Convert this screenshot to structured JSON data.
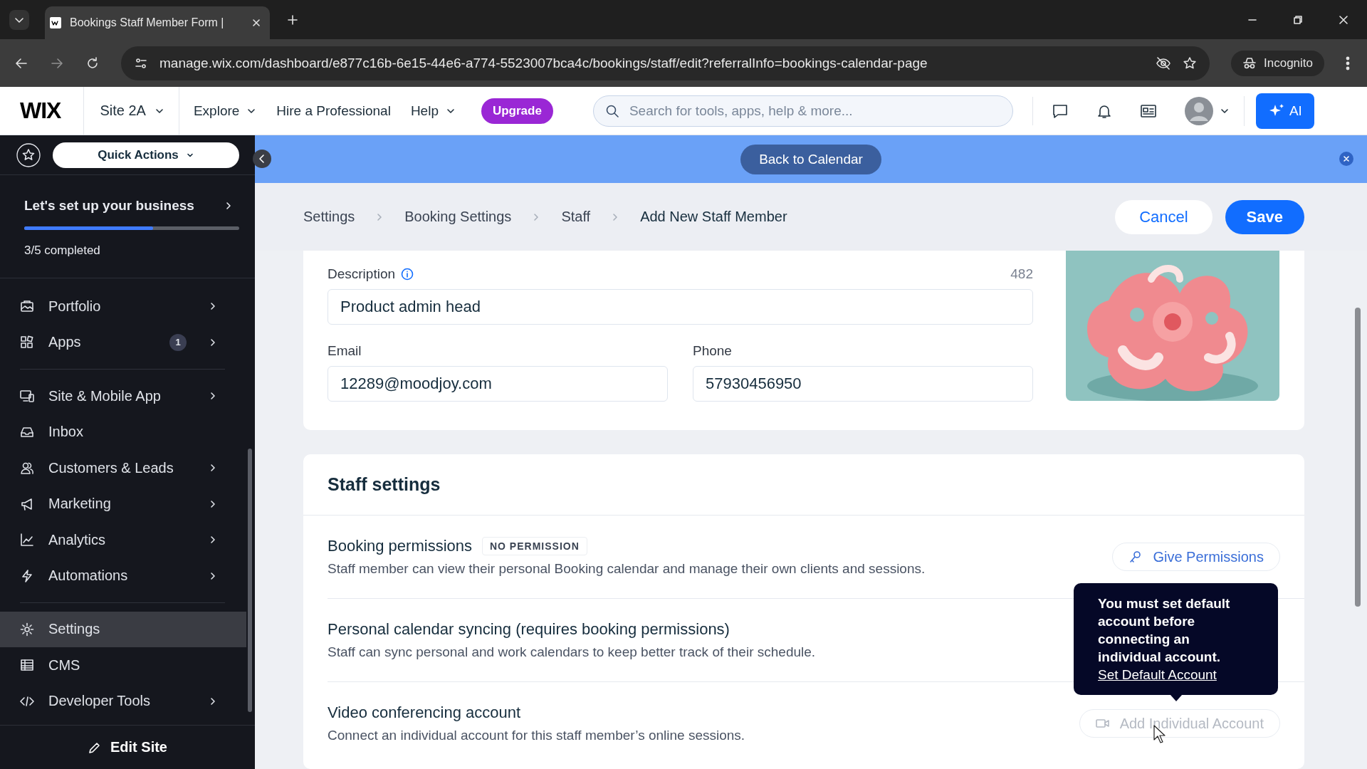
{
  "browser": {
    "tab_title": "Bookings Staff Member Form |",
    "url": "manage.wix.com/dashboard/e877c16b-6e15-44e6-a774-5523007bca4c/bookings/staff/edit?referralInfo=bookings-calendar-page",
    "profile_label": "Incognito"
  },
  "topbar": {
    "logo": "WIX",
    "site": "Site 2A",
    "nav": [
      {
        "label": "Explore",
        "dropdown": true
      },
      {
        "label": "Hire a Professional",
        "dropdown": false
      },
      {
        "label": "Help",
        "dropdown": true
      }
    ],
    "upgrade": "Upgrade",
    "search_placeholder": "Search for tools, apps, help & more...",
    "ai_button": "AI"
  },
  "sidebar": {
    "quick_actions": "Quick Actions",
    "setup": {
      "title": "Let's set up your business",
      "level": 0.6,
      "completed": "3/5 completed"
    },
    "groups": [
      [
        {
          "label": "Portfolio",
          "expandable": true,
          "selected": false
        },
        {
          "label": "Apps",
          "badge": "1",
          "expandable": true,
          "selected": false
        }
      ],
      [
        {
          "label": "Site & Mobile App",
          "expandable": true,
          "selected": false
        },
        {
          "label": "Inbox",
          "expandable": false,
          "selected": false
        },
        {
          "label": "Customers & Leads",
          "expandable": true,
          "selected": false
        },
        {
          "label": "Marketing",
          "expandable": true,
          "selected": false
        },
        {
          "label": "Analytics",
          "expandable": true,
          "selected": false
        },
        {
          "label": "Automations",
          "expandable": true,
          "selected": false
        }
      ],
      [
        {
          "label": "Settings",
          "expandable": false,
          "selected": true
        },
        {
          "label": "CMS",
          "expandable": false,
          "selected": false
        },
        {
          "label": "Developer Tools",
          "expandable": true,
          "selected": false
        }
      ]
    ],
    "edit_site": "Edit Site"
  },
  "banner": {
    "button": "Back to Calendar"
  },
  "breadcrumbs": [
    {
      "label": "Settings",
      "current": false
    },
    {
      "label": "Booking Settings",
      "current": false
    },
    {
      "label": "Staff",
      "current": false
    },
    {
      "label": "Add New Staff Member",
      "current": true
    }
  ],
  "actions": {
    "cancel": "Cancel",
    "save": "Save"
  },
  "details": {
    "description": {
      "label": "Description",
      "count": "482",
      "value": "Product admin head"
    },
    "email": {
      "label": "Email",
      "value": "12289@moodjoy.com"
    },
    "phone": {
      "label": "Phone",
      "value": "57930456950"
    }
  },
  "staff_settings": {
    "title": "Staff settings",
    "rows": [
      {
        "title": "Booking permissions",
        "badge": "NO PERMISSION",
        "description": "Staff member can view their personal Booking calendar and manage their own clients and sessions.",
        "action": {
          "label": "Give Permissions",
          "kind": "key",
          "disabled": false
        }
      },
      {
        "title": "Personal calendar syncing (requires booking permissions)",
        "description": "Staff can sync personal and work calendars to keep better track of their schedule."
      },
      {
        "title": "Video conferencing account",
        "description": "Connect an individual account for this staff member’s online sessions.",
        "action": {
          "label": "Add Individual Account",
          "kind": "camera",
          "disabled": true
        }
      }
    ]
  },
  "tooltip": {
    "text": "You must set default account before connecting an individual account.",
    "link": "Set Default Account"
  }
}
